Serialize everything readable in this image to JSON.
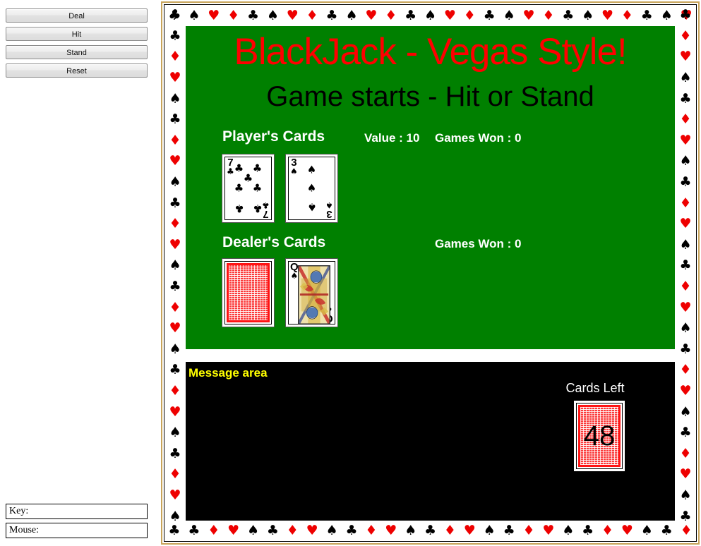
{
  "controls": {
    "deal_label": "Deal",
    "hit_label": "Hit",
    "stand_label": "Stand",
    "reset_label": "Reset"
  },
  "status_fields": {
    "key_label": "Key:",
    "key_value": "",
    "mouse_label": "Mouse:",
    "mouse_value": ""
  },
  "table": {
    "title": "BlackJack - Vegas Style!",
    "subtitle": "Game starts - Hit or Stand",
    "title_color": "#ff0000",
    "subtitle_color": "#000000",
    "felt_color": "#008000"
  },
  "player": {
    "label": "Player's Cards",
    "value_text": "Value : 10",
    "games_won_text": "Games Won : 0",
    "cards": [
      {
        "rank": "7",
        "suit": "clubs",
        "suit_glyph": "♣",
        "color": "#000000",
        "face_down": false
      },
      {
        "rank": "3",
        "suit": "spades",
        "suit_glyph": "♠",
        "color": "#000000",
        "face_down": false
      }
    ]
  },
  "dealer": {
    "label": "Dealer's Cards",
    "games_won_text": "Games Won : 0",
    "cards": [
      {
        "rank": "",
        "suit": "",
        "suit_glyph": "",
        "color": "#000000",
        "face_down": true
      },
      {
        "rank": "Q",
        "suit": "spades",
        "suit_glyph": "♠",
        "color": "#000000",
        "face_down": false
      }
    ]
  },
  "message_panel": {
    "area_label": "Message area",
    "message_text": "",
    "cards_left_label": "Cards Left",
    "cards_left_count": "48",
    "background_color": "#000000",
    "label_color": "#ffff00"
  },
  "border": {
    "frame_color": "#c8a45a",
    "red_color": "#ee0000",
    "black_color": "#000000",
    "top_sequence": [
      "clubs",
      "spades",
      "hearts",
      "diamonds",
      "clubs",
      "spades",
      "hearts",
      "diamonds",
      "clubs",
      "spades",
      "hearts",
      "diamonds",
      "clubs",
      "spades",
      "hearts",
      "diamonds",
      "clubs",
      "spades",
      "hearts",
      "diamonds",
      "clubs",
      "spades",
      "hearts",
      "diamonds",
      "clubs",
      "spades",
      "hearts"
    ],
    "bottom_sequence": [
      "clubs",
      "clubs",
      "diamonds",
      "hearts",
      "spades",
      "clubs",
      "diamonds",
      "hearts",
      "spades",
      "clubs",
      "diamonds",
      "hearts",
      "spades",
      "clubs",
      "diamonds",
      "hearts",
      "spades",
      "clubs",
      "diamonds",
      "hearts",
      "spades",
      "clubs",
      "diamonds",
      "hearts",
      "spades",
      "clubs",
      "diamonds"
    ],
    "left_sequence": [
      "clubs",
      "clubs",
      "diamonds",
      "hearts",
      "spades",
      "clubs",
      "diamonds",
      "hearts",
      "spades",
      "clubs",
      "diamonds",
      "hearts",
      "spades",
      "clubs",
      "diamonds",
      "hearts",
      "spades",
      "clubs",
      "diamonds",
      "hearts",
      "spades",
      "clubs",
      "diamonds",
      "hearts",
      "spades"
    ],
    "right_sequence": [
      "clubs",
      "diamonds",
      "hearts",
      "spades",
      "clubs",
      "diamonds",
      "hearts",
      "spades",
      "clubs",
      "diamonds",
      "hearts",
      "spades",
      "clubs",
      "diamonds",
      "hearts",
      "spades",
      "clubs",
      "diamonds",
      "hearts",
      "spades",
      "clubs",
      "diamonds",
      "hearts",
      "spades",
      "clubs"
    ]
  }
}
